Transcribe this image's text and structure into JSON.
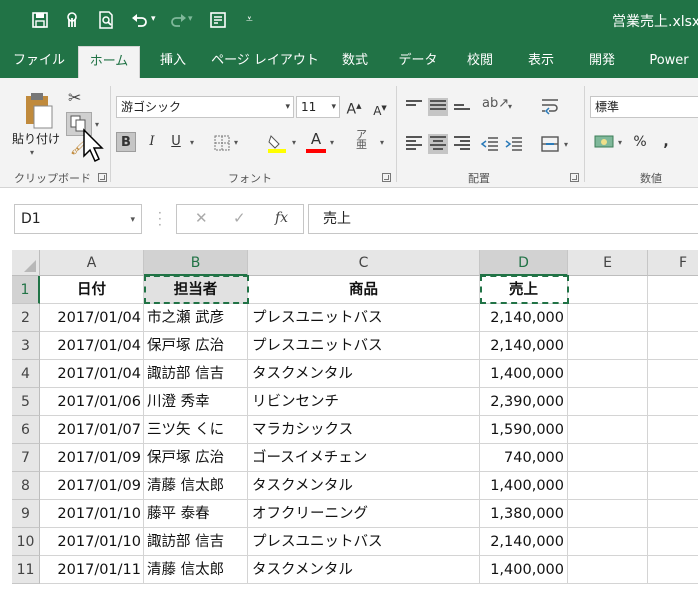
{
  "window": {
    "title": "営業売上.xlsx",
    "theme_color": "#217346"
  },
  "qat": {
    "icons": [
      "save-icon",
      "touch-mode-icon",
      "print-preview-icon",
      "undo-icon",
      "redo-icon",
      "form-icon",
      "customize-qat-icon"
    ]
  },
  "tabs": [
    {
      "label": "ファイル"
    },
    {
      "label": "ホーム"
    },
    {
      "label": "挿入"
    },
    {
      "label": "ページ レイアウト"
    },
    {
      "label": "数式"
    },
    {
      "label": "データ"
    },
    {
      "label": "校閲"
    },
    {
      "label": "表示"
    },
    {
      "label": "開発"
    },
    {
      "label": "Power"
    }
  ],
  "ribbon": {
    "clipboard": {
      "paste_label": "貼り付け",
      "group_label": "クリップボード"
    },
    "font": {
      "font_name": "游ゴシック",
      "font_size": "11",
      "group_label": "フォント",
      "bold": "B",
      "italic": "I",
      "underline": "U"
    },
    "alignment": {
      "group_label": "配置"
    },
    "number": {
      "format": "標準",
      "percent": "%",
      "comma": ",",
      "group_label": "数値"
    }
  },
  "formula_bar": {
    "name_box": "D1",
    "fx": "fx",
    "content": "売上"
  },
  "sheet": {
    "columns": [
      "A",
      "B",
      "C",
      "D",
      "E",
      "F"
    ],
    "header_row": {
      "row": "1",
      "a": "日付",
      "b": "担当者",
      "c": "商品",
      "d": "売上"
    },
    "rows": [
      {
        "row": "2",
        "date": "2017/01/04",
        "person": "市之瀬 武彦",
        "product": "プレスユニットバス",
        "sales": "2,140,000"
      },
      {
        "row": "3",
        "date": "2017/01/04",
        "person": "保戸塚 広治",
        "product": "プレスユニットバス",
        "sales": "2,140,000"
      },
      {
        "row": "4",
        "date": "2017/01/04",
        "person": "諏訪部 信吉",
        "product": "タスクメンタル",
        "sales": "1,400,000"
      },
      {
        "row": "5",
        "date": "2017/01/06",
        "person": "川澄 秀幸",
        "product": "リビンセンチ",
        "sales": "2,390,000"
      },
      {
        "row": "6",
        "date": "2017/01/07",
        "person": "三ツ矢 くに",
        "product": "マラカシックス",
        "sales": "1,590,000"
      },
      {
        "row": "7",
        "date": "2017/01/09",
        "person": "保戸塚 広治",
        "product": "ゴースイメチェン",
        "sales": "740,000"
      },
      {
        "row": "8",
        "date": "2017/01/09",
        "person": "清藤 信太郎",
        "product": "タスクメンタル",
        "sales": "1,400,000"
      },
      {
        "row": "9",
        "date": "2017/01/10",
        "person": "藤平 泰春",
        "product": "オフクリーニング",
        "sales": "1,380,000"
      },
      {
        "row": "10",
        "date": "2017/01/10",
        "person": "諏訪部 信吉",
        "product": "プレスユニットバス",
        "sales": "2,140,000"
      },
      {
        "row": "11",
        "date": "2017/01/11",
        "person": "清藤 信太郎",
        "product": "タスクメンタル",
        "sales": "1,400,000"
      }
    ]
  }
}
